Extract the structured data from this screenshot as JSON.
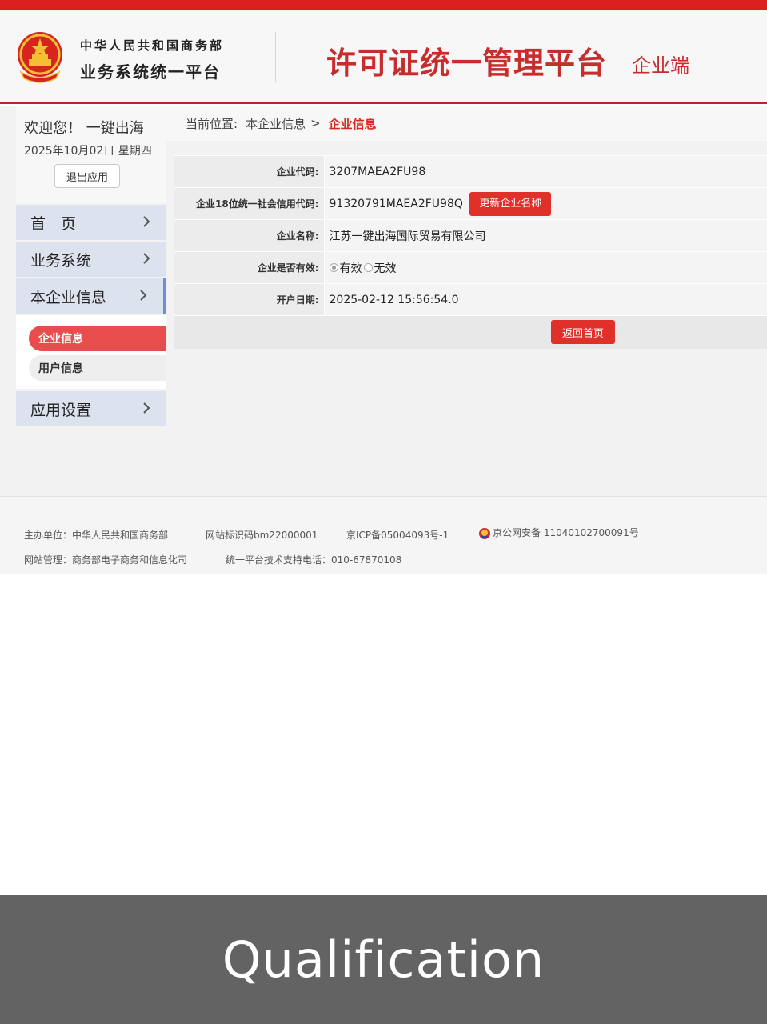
{
  "header": {
    "org_name": "中华人民共和国商务部",
    "org_platform": "业务系统统一平台",
    "platform_title": "许可证统一管理平台",
    "platform_sub": "企业端"
  },
  "sidebar": {
    "welcome": "欢迎您！ 一键出海",
    "date": "2025年10月02日 星期四",
    "logout_label": "退出应用",
    "items": [
      {
        "label": "首　页"
      },
      {
        "label": "业务系统"
      },
      {
        "label": "本企业信息"
      },
      {
        "label": "应用设置"
      }
    ],
    "subitems": [
      {
        "label": "企业信息"
      },
      {
        "label": "用户信息"
      }
    ]
  },
  "breadcrumb": {
    "prefix": "当前位置:",
    "parent": "本企业信息",
    "separator": ">",
    "current": "企业信息"
  },
  "enterprise": {
    "rows": [
      {
        "label": "企业代码:",
        "value": "3207MAEA2FU98"
      },
      {
        "label": "企业18位统一社会信用代码:",
        "value": "91320791MAEA2FU98Q"
      },
      {
        "label": "企业名称:",
        "value": "江苏一键出海国际贸易有限公司"
      },
      {
        "label": "企业是否有效:",
        "value": ""
      },
      {
        "label": "开户日期:",
        "value": "2025-02-12 15:56:54.0"
      }
    ],
    "update_name_label": "更新企业名称",
    "valid_options": [
      "有效",
      "无效"
    ],
    "valid_selected": "有效",
    "back_home_label": "返回首页"
  },
  "footer": {
    "host": "主办单位：中华人民共和国商务部",
    "site_id": "网站标识码bm22000001",
    "icp": "京ICP备05004093号-1",
    "police": "京公网安备 11040102700091号",
    "manager": "网站管理：商务部电子商务和信息化司",
    "support": "统一平台技术支持电话：010-67870108"
  },
  "banner": {
    "text": "Qualification"
  },
  "colors": {
    "brand_red": "#d9201d",
    "title_red": "#c72d2d",
    "nav_bg": "#dde3ee",
    "nav_active_border": "#6f8fd0",
    "banner_bg": "#636363"
  }
}
